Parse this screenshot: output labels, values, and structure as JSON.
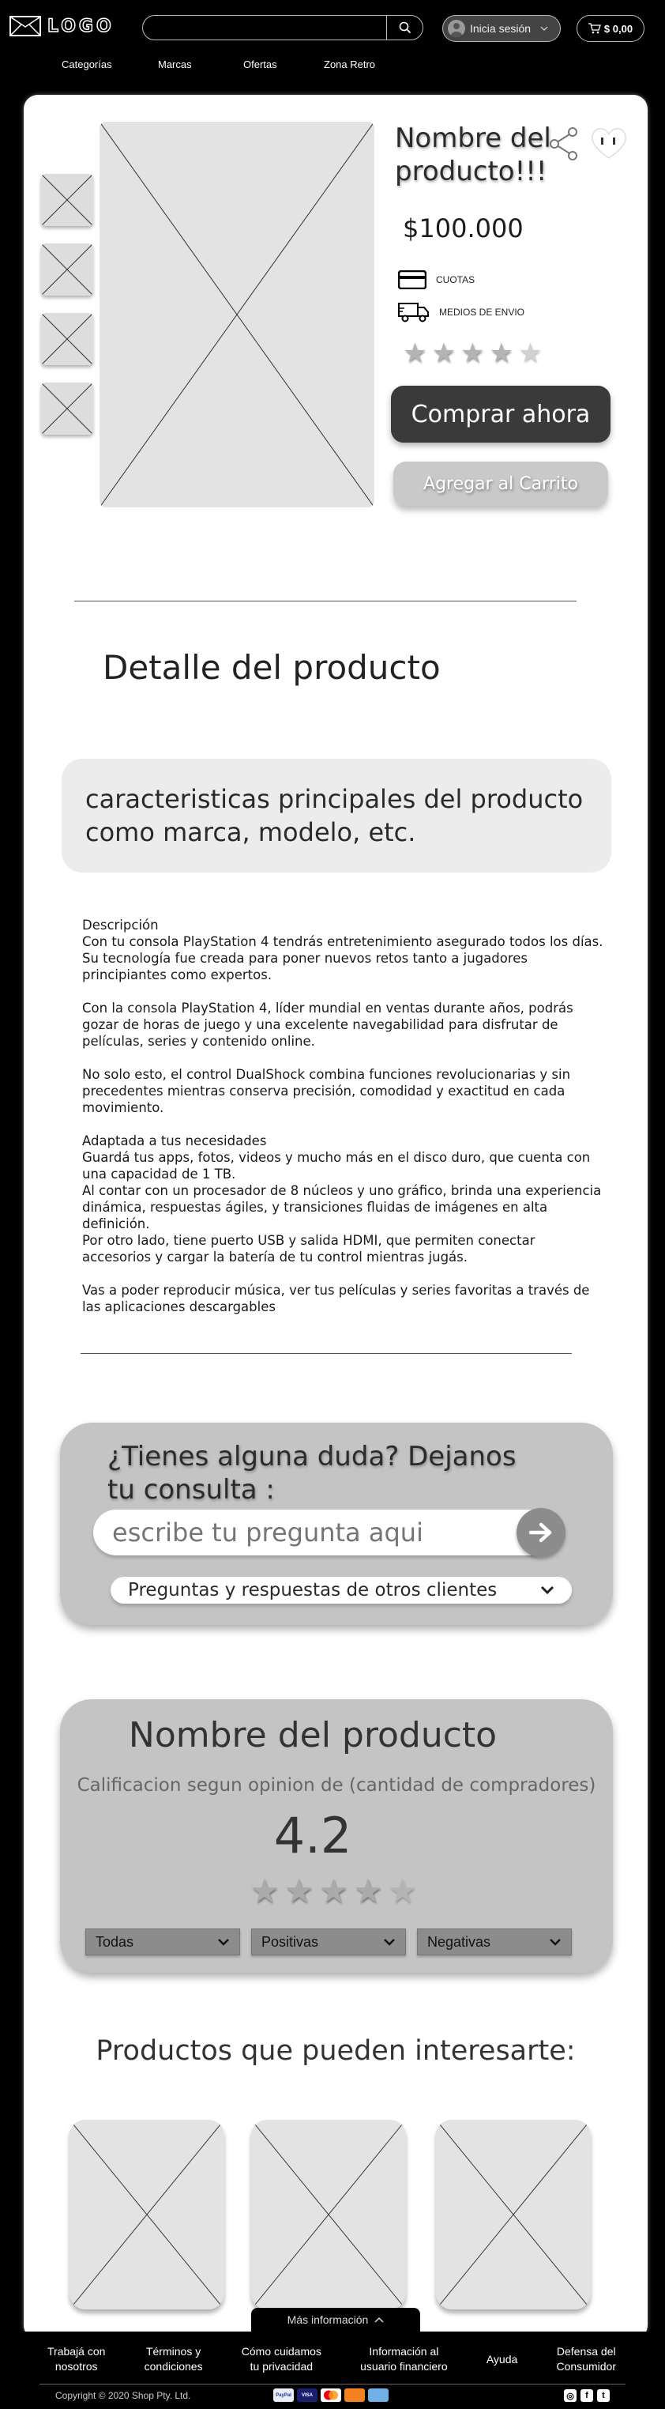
{
  "header": {
    "logo_text": "LOGO",
    "search_placeholder": "",
    "login_label": "Inicia sesión",
    "cart_total": "$ 0,00",
    "nav": [
      "Categorías",
      "Marcas",
      "Ofertas",
      "Zona Retro"
    ]
  },
  "product": {
    "title": "Nombre del producto!!!",
    "price": "$100.000",
    "installments_label": "CUOTAS",
    "shipping_label": "MEDIOS DE ENVIO",
    "rating_stars": 4.5,
    "buy_label": "Comprar ahora",
    "add_cart_label": "Agregar al Carrito"
  },
  "detail": {
    "title": "Detalle del producto",
    "features": "caracteristicas principales del producto como marca, modelo, etc.",
    "description": [
      "Descripción\nCon tu consola PlayStation 4 tendrás entretenimiento asegurado todos los días. Su tecnología fue creada para poner nuevos retos tanto a jugadores principiantes como expertos.",
      "Con la consola PlayStation 4, líder mundial en ventas durante años, podrás gozar de horas de juego y una excelente navegabilidad para disfrutar de películas, series y contenido online.",
      "No solo esto, el control DualShock combina funciones revolucionarias y sin precedentes mientras conserva precisión, comodidad y exactitud en cada movimiento.",
      "Adaptada a tus necesidades\nGuardá tus apps, fotos, videos y mucho más en el disco duro, que cuenta con una capacidad de 1 TB.\nAl contar con un procesador de 8 núcleos y uno gráfico, brinda una experiencia dinámica, respuestas ágiles, y transiciones fluidas de imágenes en alta definición.\nPor otro lado, tiene puerto USB y salida HDMI, que permiten conectar accesorios y cargar la batería de tu control mientras jugás.",
      "Vas a poder reproducir música, ver tus películas y series favoritas a través de las aplicaciones descargables"
    ]
  },
  "questions": {
    "title": "¿Tienes alguna duda? Dejanos tu consulta :",
    "placeholder": "escribe tu pregunta aqui",
    "faq_label": "Preguntas y respuestas de otros clientes"
  },
  "reviews": {
    "product_name": "Nombre del producto",
    "subtitle": "Calificacion segun opinion de (cantidad de compradores)",
    "score": "4.2",
    "rating_stars": 4.5,
    "filters": [
      "Todas",
      "Positivas",
      "Negativas"
    ]
  },
  "related": {
    "title": "Productos que pueden interesarte:"
  },
  "footer": {
    "more_info": "Más información",
    "links": [
      "Trabajá con\nnosotros",
      "Términos y\ncondiciones",
      "Cómo cuidamos\ntu privacidad",
      "Información al\nusuario financiero",
      "Ayuda",
      "Defensa del\nConsumidor"
    ],
    "copyright": "Copyright © 2020 Shop Pty. Ltd.",
    "payments": [
      "PayPal",
      "VISA",
      "Mastercard",
      "Discover",
      "Amex"
    ],
    "social": [
      "instagram-icon",
      "facebook-icon",
      "twitter-icon"
    ]
  },
  "colors": {
    "background": "#000000",
    "card": "#ffffff",
    "panel_gray": "#c4c4c4",
    "button_dark": "#3a3a3a"
  }
}
